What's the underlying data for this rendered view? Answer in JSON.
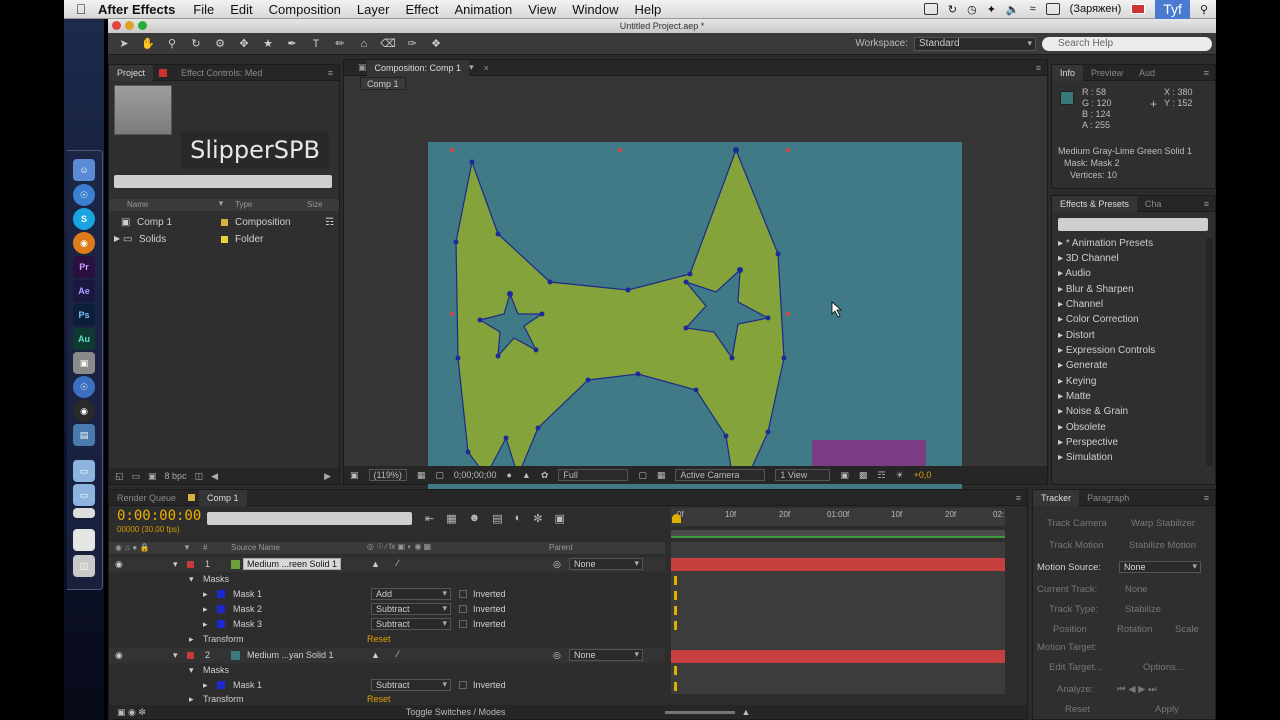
{
  "menubar": {
    "app": "After Effects",
    "items": [
      "File",
      "Edit",
      "Composition",
      "Layer",
      "Effect",
      "Animation",
      "View",
      "Window",
      "Help"
    ],
    "battery_status": "(Заряжен)",
    "user_badge": "Tyf"
  },
  "window": {
    "title": "Untitled Project.aep *"
  },
  "toolbar": {
    "workspace_label": "Workspace:",
    "workspace_value": "Standard",
    "search_help_placeholder": "Search Help"
  },
  "project_panel": {
    "tab_project": "Project",
    "tab_effect_controls": "Effect Controls: Med",
    "watermark": "SlipperSPB",
    "columns": {
      "name": "Name",
      "type": "Type",
      "size": "Size"
    },
    "rows": [
      {
        "name": "Comp 1",
        "type": "Composition",
        "color": "#d6b33a"
      },
      {
        "name": "Solids",
        "type": "Folder",
        "color": "#e3d53a"
      }
    ],
    "bpc": "8 bpc"
  },
  "comp_panel": {
    "tab": "Composition: Comp 1",
    "sub_tab": "Comp 1",
    "zoom": "(119%)",
    "timecode": "0;00;00;00",
    "resolution": "Full",
    "camera": "Active Camera",
    "view": "1 View",
    "exposure": "+0,0",
    "bg_color": "#3f7a86",
    "shape_color": "#84a33a",
    "rect_color": "#7a3d83"
  },
  "info_panel": {
    "tab_info": "Info",
    "tab_preview": "Preview",
    "tab_audio": "Aud",
    "r": "R : 58",
    "g": "G : 120",
    "b": "B : 124",
    "a": "A : 255",
    "x": "X : 380",
    "y": "Y : 152",
    "layer_name": "Medium Gray-Lime Green Solid 1",
    "mask": "Mask: Mask 2",
    "vertices": "Vertices: 10"
  },
  "effects_panel": {
    "tab": "Effects & Presets",
    "tab2": "Cha",
    "items": [
      "* Animation Presets",
      "3D Channel",
      "Audio",
      "Blur & Sharpen",
      "Channel",
      "Color Correction",
      "Distort",
      "Expression Controls",
      "Generate",
      "Keying",
      "Matte",
      "Noise & Grain",
      "Obsolete",
      "Perspective",
      "Simulation"
    ]
  },
  "timeline": {
    "tab_render": "Render Queue",
    "tab_comp": "Comp 1",
    "current_time": "0:00:00:00",
    "fps": "00000 (30.00 fps)",
    "headers": {
      "source": "Source Name",
      "parent": "Parent"
    },
    "ruler": [
      "0f",
      "10f",
      "20f",
      "01:00f",
      "10f",
      "20f",
      "02:"
    ],
    "rows": [
      {
        "kind": "layer",
        "num": "1",
        "name": "Medium ...reen Solid 1",
        "parent": "None",
        "color": "#c83a3a",
        "swatch": "#6aa03a"
      },
      {
        "kind": "group",
        "name": "Masks"
      },
      {
        "kind": "mask",
        "name": "Mask 1",
        "mode": "Add",
        "inverted": "Inverted"
      },
      {
        "kind": "mask",
        "name": "Mask 2",
        "mode": "Subtract",
        "inverted": "Inverted"
      },
      {
        "kind": "mask",
        "name": "Mask 3",
        "mode": "Subtract",
        "inverted": "Inverted"
      },
      {
        "kind": "group",
        "name": "Transform",
        "extra": "Reset"
      },
      {
        "kind": "layer",
        "num": "2",
        "name": "Medium ...yan Solid 1",
        "parent": "None",
        "color": "#c83a3a",
        "swatch": "#3c7a80"
      },
      {
        "kind": "group",
        "name": "Masks"
      },
      {
        "kind": "mask",
        "name": "Mask 1",
        "mode": "Subtract",
        "inverted": "Inverted"
      },
      {
        "kind": "group",
        "name": "Transform",
        "extra": "Reset"
      }
    ],
    "toggle_label": "Toggle Switches / Modes"
  },
  "tracker": {
    "tab": "Tracker",
    "tab2": "Paragraph",
    "track_camera": "Track Camera",
    "warp_stabilizer": "Warp Stabilizer",
    "track_motion": "Track Motion",
    "stabilize_motion": "Stabilize Motion",
    "motion_source_label": "Motion Source:",
    "motion_source_value": "None",
    "current_track_label": "Current Track:",
    "current_track_value": "None",
    "track_type_label": "Track Type:",
    "track_type_value": "Stabilize",
    "position": "Position",
    "rotation": "Rotation",
    "scale": "Scale",
    "motion_target": "Motion Target:",
    "edit_target": "Edit Target...",
    "options": "Options...",
    "analyze": "Analyze:",
    "reset": "Reset",
    "apply": "Apply"
  }
}
